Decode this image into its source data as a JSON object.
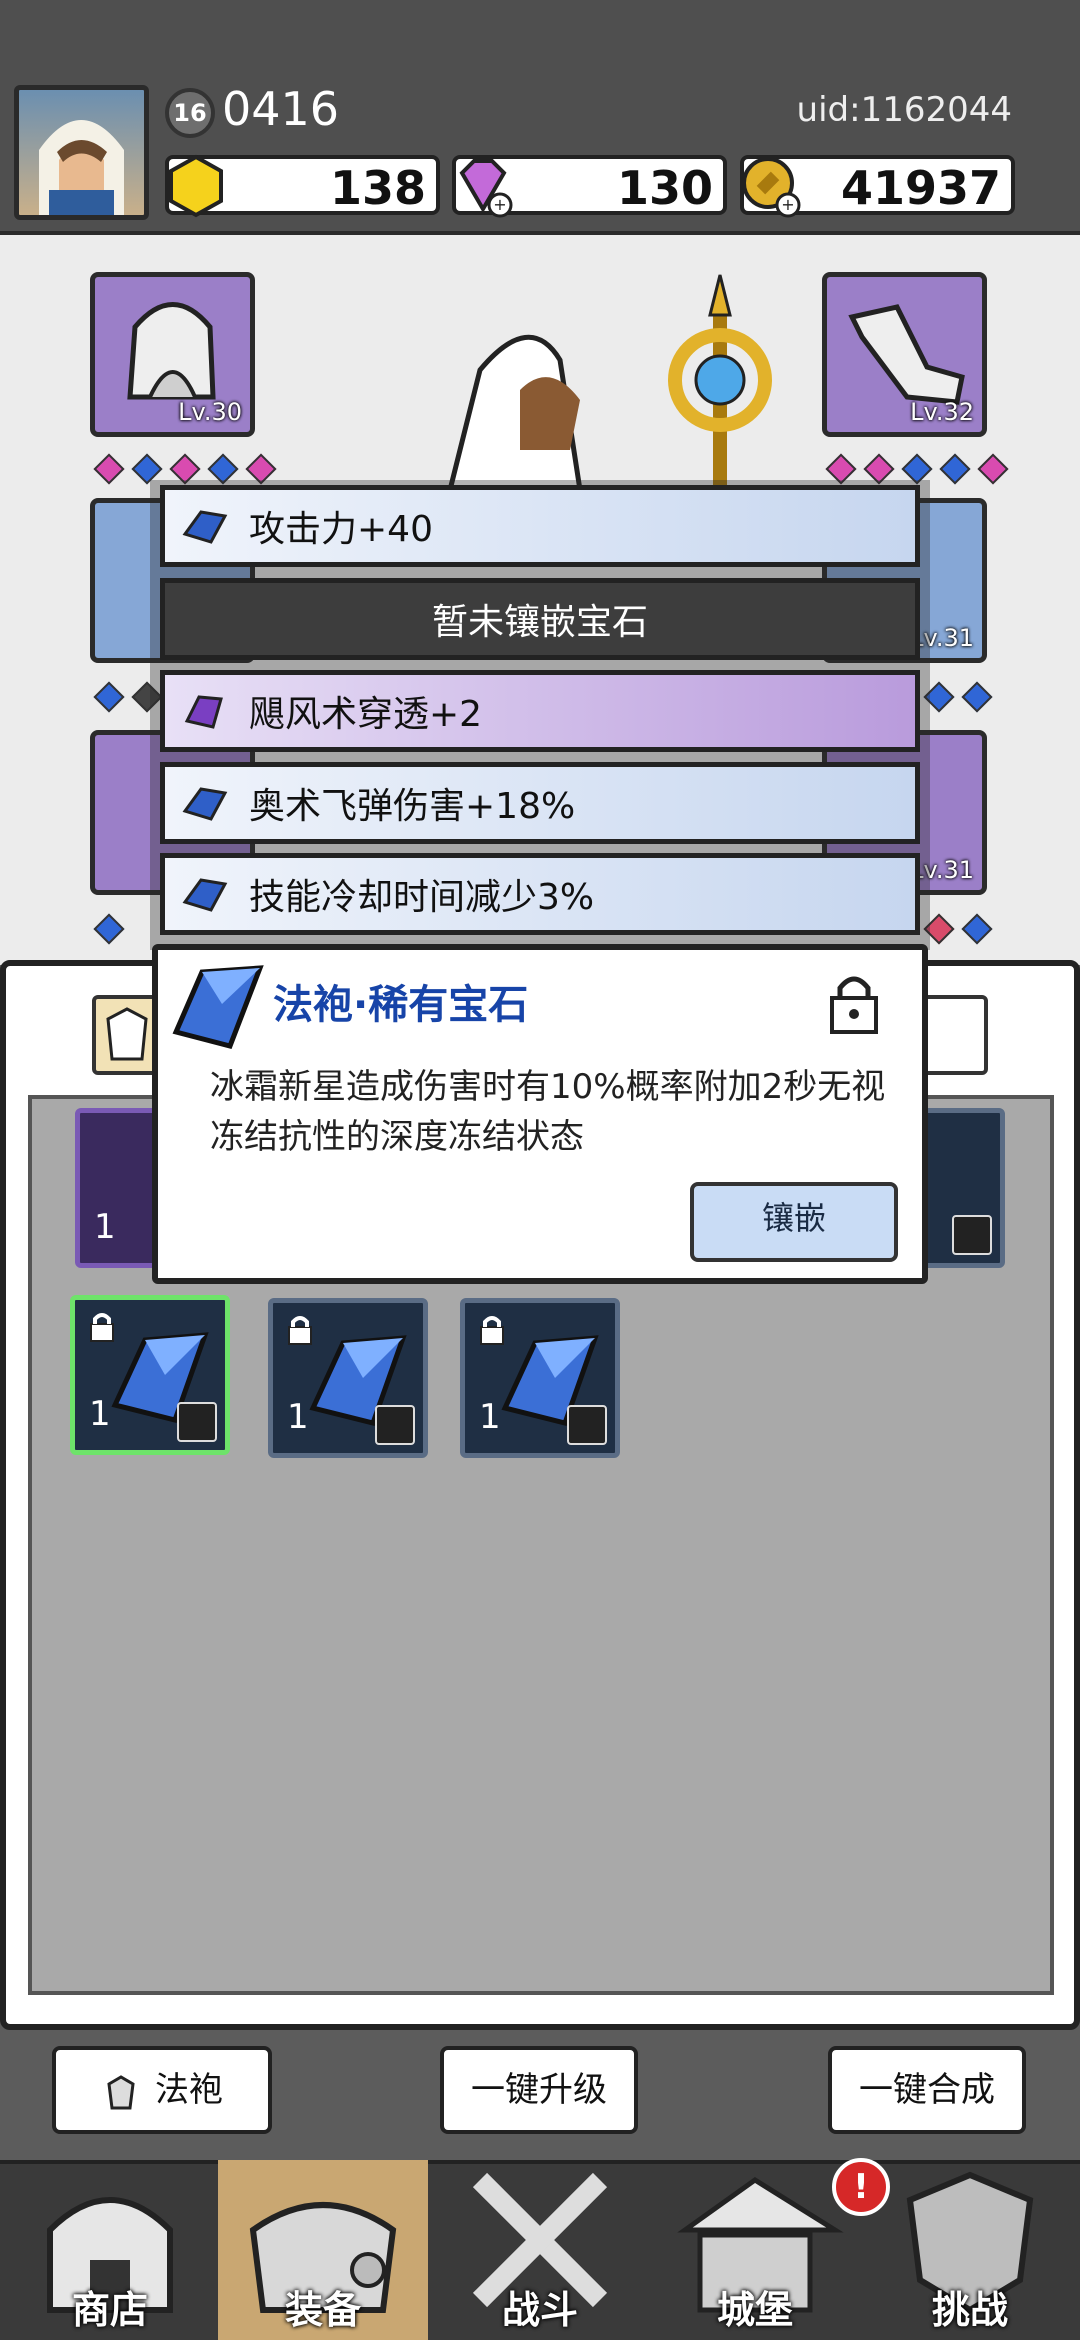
{
  "header": {
    "level": "16",
    "player_id": "0416",
    "uid": "uid:1162044",
    "resources": {
      "gold_gem": "138",
      "diamond": "130",
      "coin": "41937"
    }
  },
  "equipment": {
    "slots": [
      {
        "level": "Lv.30"
      },
      {
        "level": "Lv.32"
      },
      {
        "level": "Lv.31"
      },
      {
        "level": "Lv.31"
      }
    ]
  },
  "gem_slots": [
    {
      "text": "攻击力+40"
    },
    {
      "text": "暂未镶嵌宝石"
    },
    {
      "text": "飓风术穿透+2"
    },
    {
      "text": "奥术飞弹伤害+18%"
    },
    {
      "text": "技能冷却时间减少3%"
    }
  ],
  "tooltip": {
    "title": "法袍·稀有宝石",
    "description": "冰霜新星造成伤害时有10%概率附加2秒无视冻结抗性的深度冻结状态",
    "button": "镶嵌"
  },
  "inventory": {
    "items": [
      {
        "count": "1"
      },
      {
        "count": "1"
      },
      {
        "count": "1"
      },
      {
        "count": "1"
      },
      {
        "count": "1"
      }
    ]
  },
  "actions": {
    "category": "法袍",
    "upgrade_all": "一键升级",
    "merge_all": "一键合成"
  },
  "nav": {
    "shop": "商店",
    "equipment": "装备",
    "battle": "战斗",
    "castle": "城堡",
    "challenge": "挑战",
    "castle_alert": "!"
  },
  "colors": {
    "accent_blue": "#1744a8",
    "slot_purple": "#9b7fc8",
    "slot_blue": "#86a7d6",
    "selected_green": "#6ee36a",
    "alert_red": "#d62828"
  }
}
